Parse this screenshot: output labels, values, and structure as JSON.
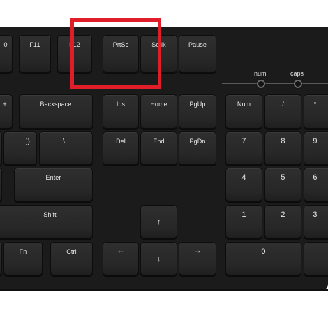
{
  "image": {
    "alt_subject": "keyboard",
    "highlight_color": "#e01e2a",
    "key_color": "#2b2b2b",
    "body_color": "#1b1b1b"
  },
  "keys": {
    "row_f": {
      "f10_partial": "0",
      "f11": "F11",
      "f12": "F12",
      "prtsc": "PrtSc",
      "scrlk": "Scrlk",
      "pause": "Pause"
    },
    "row_nav1": {
      "plus_partial": "+",
      "backspace": "Backspace",
      "ins": "Ins",
      "home": "Home",
      "pgup": "PgUp",
      "num": "Num",
      "slash": "/",
      "star": "*"
    },
    "row_nav2": {
      "bracket": "]}",
      "backslash": "\\ |",
      "del": "Del",
      "end": "End",
      "pgdn": "PgDn",
      "n7": "7",
      "n8": "8",
      "n9": "9"
    },
    "row_home": {
      "enter": "Enter",
      "n4": "4",
      "n5": "5",
      "n6": "6"
    },
    "row_shift": {
      "shift": "Shift",
      "up": "↑",
      "n1": "1",
      "n2": "2",
      "n3": "3"
    },
    "row_bottom": {
      "fn": "Fn",
      "ctrl": "Ctrl",
      "left": "←",
      "down": "↓",
      "right": "→",
      "n0": "0",
      "dot": "."
    }
  },
  "indicators": {
    "num": "num",
    "caps": "caps"
  }
}
